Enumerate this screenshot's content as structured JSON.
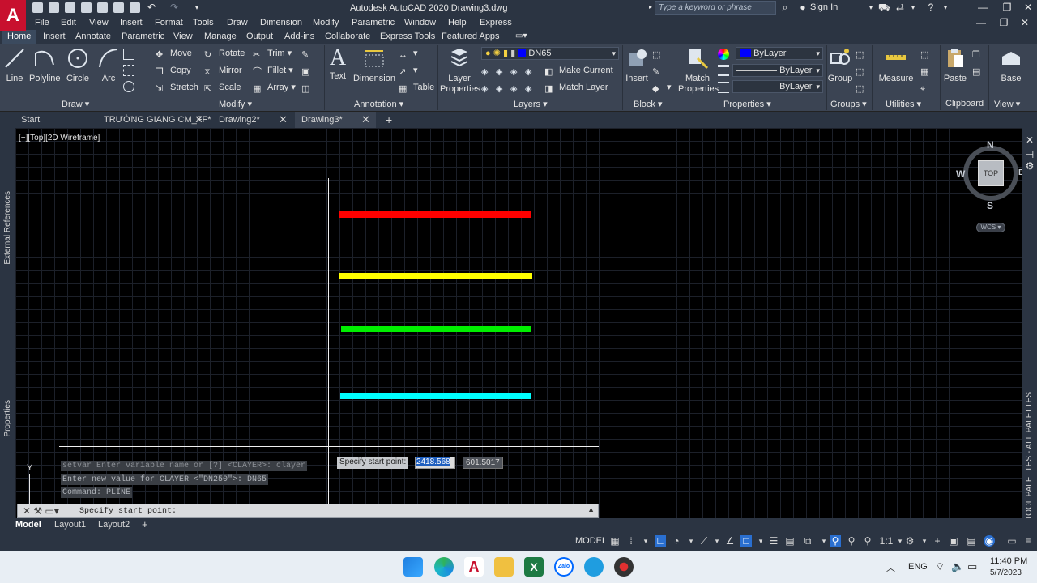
{
  "titlebar": {
    "title": "Autodesk AutoCAD 2020    Drawing3.dwg",
    "search_placeholder": "Type a keyword or phrase",
    "signin": "Sign In"
  },
  "menu": [
    "File",
    "Edit",
    "View",
    "Insert",
    "Format",
    "Tools",
    "Draw",
    "Dimension",
    "Modify",
    "Parametric",
    "Window",
    "Help",
    "Express"
  ],
  "ribbon_tabs": [
    "Home",
    "Insert",
    "Annotate",
    "Parametric",
    "View",
    "Manage",
    "Output",
    "Add-ins",
    "Collaborate",
    "Express Tools",
    "Featured Apps"
  ],
  "ribbon": {
    "draw": {
      "title": "Draw",
      "line": "Line",
      "polyline": "Polyline",
      "circle": "Circle",
      "arc": "Arc"
    },
    "modify": {
      "title": "Modify",
      "move": "Move",
      "rotate": "Rotate",
      "trim": "Trim",
      "copy": "Copy",
      "mirror": "Mirror",
      "fillet": "Fillet",
      "stretch": "Stretch",
      "scale": "Scale",
      "array": "Array"
    },
    "annotation": {
      "title": "Annotation",
      "text": "Text",
      "dimension": "Dimension",
      "table": "Table"
    },
    "layers": {
      "title": "Layers",
      "layer_properties": "Layer Properties",
      "current_layer": "DN65",
      "make_current": "Make Current",
      "match_layer": "Match Layer"
    },
    "block": {
      "title": "Block",
      "insert": "Insert"
    },
    "properties": {
      "title": "Properties",
      "match_properties": "Match Properties",
      "color": "ByLayer",
      "lineweight": "ByLayer",
      "linetype": "ByLayer"
    },
    "groups": {
      "title": "Groups",
      "group": "Group"
    },
    "utilities": {
      "title": "Utilities",
      "measure": "Measure"
    },
    "clipboard": {
      "title": "Clipboard",
      "paste": "Paste"
    },
    "view": {
      "title": "View",
      "base": "Base"
    }
  },
  "file_tabs": [
    {
      "label": "Start"
    },
    {
      "label": "TRƯỜNG GIANG CM_FF*"
    },
    {
      "label": "Drawing2*"
    },
    {
      "label": "Drawing3*"
    }
  ],
  "palettes": {
    "external_references": "External References",
    "properties": "Properties",
    "tool_palettes": "TOOL PALETTES - ALL PALETTES"
  },
  "viewport": {
    "label": "[−][Top][2D Wireframe]",
    "cube_face": "TOP",
    "compass_n": "N",
    "compass_s": "S",
    "compass_w": "W",
    "compass_e": "E",
    "wcs": "WCS",
    "ucs_y": "Y"
  },
  "layer_lines": [
    {
      "color": "#ff0000"
    },
    {
      "color": "#ffff00"
    },
    {
      "color": "#00ee00"
    },
    {
      "color": "#00ffff"
    }
  ],
  "command_history": [
    "setvar Enter variable name or [?] <CLAYER>: clayer",
    "Enter new value for CLAYER <\"DN250\">: DN65",
    "Command: PLINE"
  ],
  "command_line": {
    "value": "Specify start point:"
  },
  "dynamic_input": {
    "prompt": "Specify start point:",
    "x": "2418.568",
    "y": "601.5017"
  },
  "layout_tabs": [
    "Model",
    "Layout1",
    "Layout2"
  ],
  "status": {
    "model": "MODEL",
    "scale": "1:1"
  },
  "taskbar": {
    "lang": "ENG",
    "time": "11:40 PM",
    "date": "5/7/2023"
  }
}
